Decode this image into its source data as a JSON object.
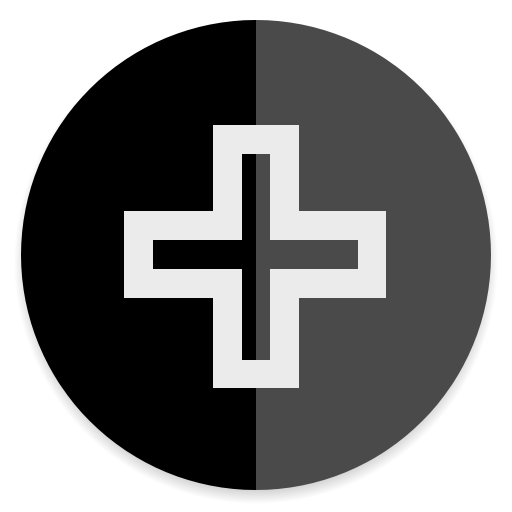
{
  "icon": {
    "name": "medical-cross-app-icon",
    "colors": {
      "left_half": "#000000",
      "right_half": "#4a4a4a",
      "cross_outline": "#ebebeb",
      "background": "#ffffff",
      "shadow": "#9e9e9e"
    }
  }
}
